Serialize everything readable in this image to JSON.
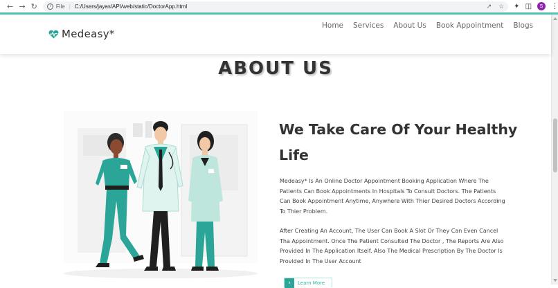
{
  "browser": {
    "scheme_label": "File",
    "url": "C:/Users/jayas/API/web/static/DoctorApp.html",
    "profile_initial": "S"
  },
  "site": {
    "logo_text": "Medeasy*",
    "accent_color": "#2aa597",
    "menu": [
      {
        "label": "Home"
      },
      {
        "label": "Services"
      },
      {
        "label": "About Us"
      },
      {
        "label": "Book Appointment"
      },
      {
        "label": "Blogs"
      }
    ]
  },
  "about": {
    "title": "ABOUT US",
    "heading": "We Take Care Of Your Healthy Life",
    "paragraph1": "Medeasy* Is An Online Doctor Appointment Booking Application Where The Patients Can Book Appointments In Hospitals To Consult Doctors. The Patients Can Book Appointment Anytime, Anywhere With Thier Desired Doctors According To Thier Problem.",
    "paragraph2": "After Creating An Account, The User Can Book A Slot Or They Can Even Cancel Tha Appointment. Once The Patient Consulted The Doctor , The Reports Are Also Provided In The Application Itself. Also The Medical Prescription By The Doctor Is Provided In The User Account",
    "button_label": "Learn More"
  }
}
